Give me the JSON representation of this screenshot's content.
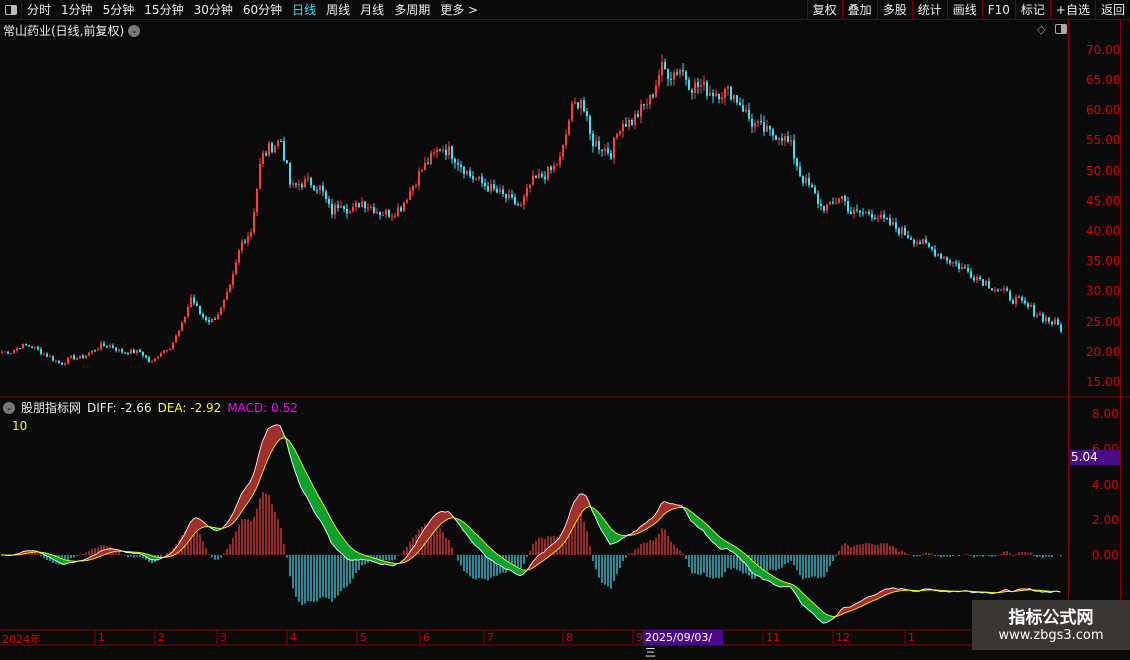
{
  "toolbar": {
    "periods": [
      "分时",
      "1分钟",
      "5分钟",
      "15分钟",
      "30分钟",
      "60分钟",
      "日线",
      "周线",
      "月线",
      "多周期",
      "更多 >"
    ],
    "active": "日线",
    "right_buttons": [
      "复权",
      "叠加",
      "多股",
      "统计",
      "画线",
      "F10",
      "标记",
      "+自选",
      "返回"
    ]
  },
  "title": "常山药业(日线,前复权)",
  "indicator": {
    "name": "股朋指标网",
    "diff": "DIFF: -2.66",
    "dea": "DEA: -2.92",
    "macd": "MACD: 0.52",
    "param": "10"
  },
  "price_axis": [
    "70.00",
    "65.00",
    "60.00",
    "55.00",
    "50.00",
    "45.00",
    "40.00",
    "35.00",
    "30.00",
    "25.00",
    "20.00",
    "15.00"
  ],
  "macd_axis": [
    "8.00",
    "6.00",
    "4.00",
    "2.00",
    "0.00"
  ],
  "cursor_value": "5.04",
  "cursor_date": "2025/09/03/三",
  "x_axis": [
    "2024年",
    "1",
    "2",
    "3",
    "4",
    "5",
    "6",
    "7",
    "8",
    "9",
    "11",
    "12",
    "1"
  ],
  "watermark": {
    "name": "指标公式网",
    "url": "www.zbgs3.com"
  },
  "colors": {
    "up": "#ff3b3b",
    "down": "#2ee6ff",
    "grid": "#8b0000",
    "diff_over": "#a0302c",
    "dea_over": "#10a030"
  },
  "chart_data": {
    "type": "candlestick",
    "ylim": [
      14,
      72
    ],
    "closes": [
      20,
      20,
      21,
      21,
      20,
      19,
      18,
      19,
      19,
      20,
      21,
      21,
      20,
      20,
      20,
      18,
      20,
      21,
      24,
      29,
      26,
      25,
      27,
      31,
      38,
      40,
      52,
      54,
      55,
      47,
      48,
      48,
      47,
      43,
      45,
      43,
      45,
      44,
      43,
      43,
      44,
      47,
      50,
      52,
      54,
      53,
      51,
      49,
      48,
      47,
      46,
      45,
      44,
      48,
      49,
      50,
      52,
      60,
      62,
      55,
      54,
      53,
      58,
      58,
      60,
      62,
      67,
      66,
      67,
      64,
      64,
      63,
      63,
      63,
      61,
      58,
      57,
      56,
      56,
      54,
      49,
      47,
      44,
      44,
      46,
      43,
      43,
      43,
      42
    ],
    "indicator": "MACD(DIFF,DEA,MACD)"
  }
}
